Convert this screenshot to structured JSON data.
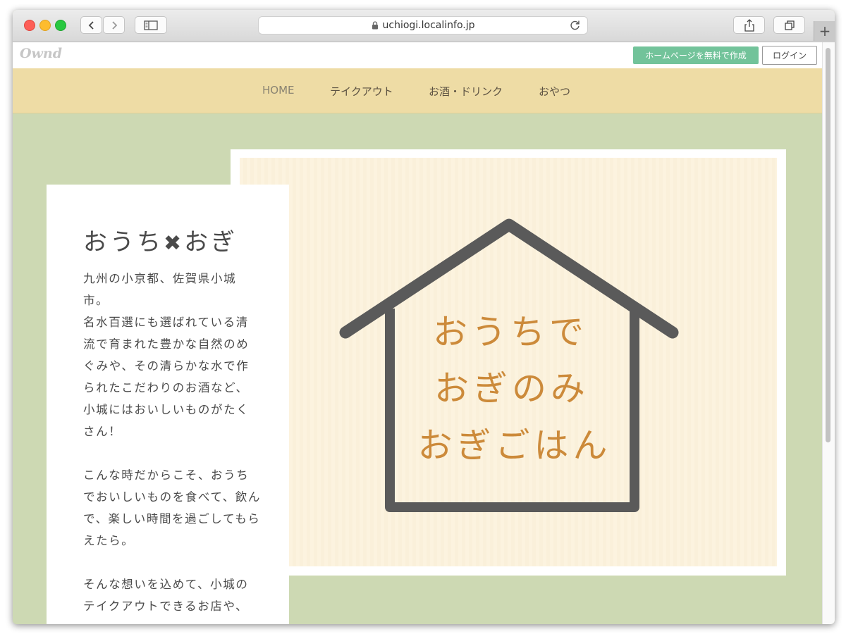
{
  "browser": {
    "url": "uchiogi.localinfo.jp"
  },
  "ownd_bar": {
    "logo": "Ownd",
    "create_button": "ホームページを無料で作成",
    "login_button": "ログイン"
  },
  "nav": {
    "items": [
      {
        "label": "HOME"
      },
      {
        "label": "テイクアウト"
      },
      {
        "label": "お酒・ドリンク"
      },
      {
        "label": "おやつ"
      }
    ]
  },
  "card": {
    "title_left": "おうち",
    "title_cross": "✖",
    "title_right": "おぎ",
    "paragraphs": [
      "九州の小京都、佐賀県小城市。",
      "名水百選にも選ばれている清流で育まれた豊かな自然のめぐみや、その清らかな水で作られたこだわりのお酒など、小城にはおいしいものがたくさん！",
      "こんな時だからこそ、おうちでおいしいものを食べて、飲んで、楽しい時間を過ごしてもらえたら。",
      "そんな想いを込めて、小城のテイクアウトできるお店や、"
    ]
  },
  "hero": {
    "lines": [
      "おうちで",
      "おぎのみ",
      "おぎごはん"
    ],
    "house_color": "#5a5a5a",
    "text_color": "#cc8a3a"
  },
  "colors": {
    "page_bg": "#cdd9b3",
    "nav_bg": "#eedca5",
    "create_button": "#72c39a"
  }
}
